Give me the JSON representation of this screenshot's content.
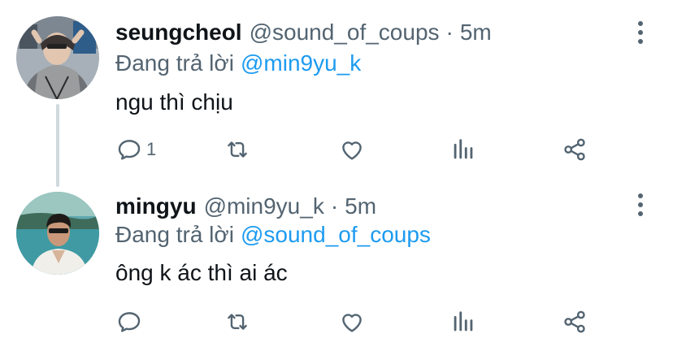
{
  "tweets": [
    {
      "name": "seungcheol",
      "handle": "@sound_of_coups",
      "separator": "·",
      "time": "5m",
      "reply_prefix": "Đang trả lời",
      "reply_to": "@min9yu_k",
      "text": "ngu thì chịu",
      "reply_count": "1",
      "has_thread_line": true
    },
    {
      "name": "mingyu",
      "handle": "@min9yu_k",
      "separator": "·",
      "time": "5m",
      "reply_prefix": "Đang trả lời",
      "reply_to": "@sound_of_coups",
      "text": "ông k ác thì ai ác",
      "reply_count": "",
      "has_thread_line": false
    }
  ],
  "icons": [
    "reply-icon",
    "retweet-icon",
    "like-icon",
    "stats-icon",
    "share-icon",
    "more-icon"
  ],
  "colors": {
    "text_primary": "#0f1419",
    "text_secondary": "#536471",
    "accent": "#1d9bf0",
    "thread_line": "#cfd9de"
  }
}
